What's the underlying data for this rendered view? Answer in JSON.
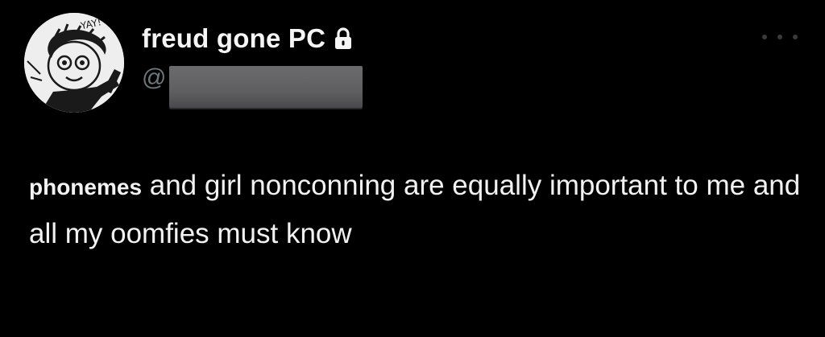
{
  "author": {
    "display_name": "freud gone PC",
    "handle_prefix": "@",
    "protected_icon": "lock-icon",
    "avatar_caption": "YAY!"
  },
  "more_icon": "more-dots-icon",
  "tweet": {
    "bold_word": "phonemes",
    "body": " and girl nonconning are equally important to me and all my oomfies must know"
  },
  "colors": {
    "background": "#000000",
    "text": "#f2f2f2",
    "muted": "#6e767d",
    "redaction": "#5f5f62"
  }
}
